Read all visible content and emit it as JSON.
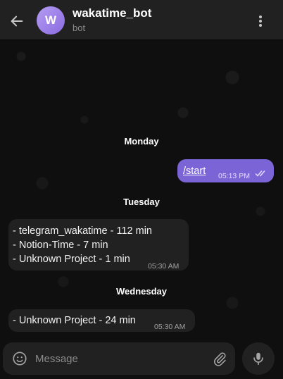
{
  "header": {
    "avatar_letter": "W",
    "title": "wakatime_bot",
    "subtitle": "bot"
  },
  "messages": [
    {
      "date": "Monday"
    },
    {
      "text": "/start",
      "time": "05:13 PM",
      "direction": "out"
    },
    {
      "date": "Tuesday"
    },
    {
      "lines": [
        "- telegram_wakatime - 112 min",
        "- Notion-Time - 7 min",
        "- Unknown Project - 1 min"
      ],
      "time": "05:30 AM",
      "direction": "in"
    },
    {
      "date": "Wednesday"
    },
    {
      "lines": [
        "- Unknown Project - 24 min"
      ],
      "time": "05:30 AM",
      "direction": "in"
    }
  ],
  "composer": {
    "placeholder": "Message"
  },
  "icons": {
    "back": "arrow-left-icon",
    "menu": "more-vertical-icon",
    "emoji": "smile-icon",
    "attach": "paperclip-icon",
    "mic": "microphone-icon",
    "read": "double-check-icon"
  },
  "colors": {
    "accent": "#7b64d6",
    "incoming_bubble": "#212121",
    "header": "#212121"
  }
}
